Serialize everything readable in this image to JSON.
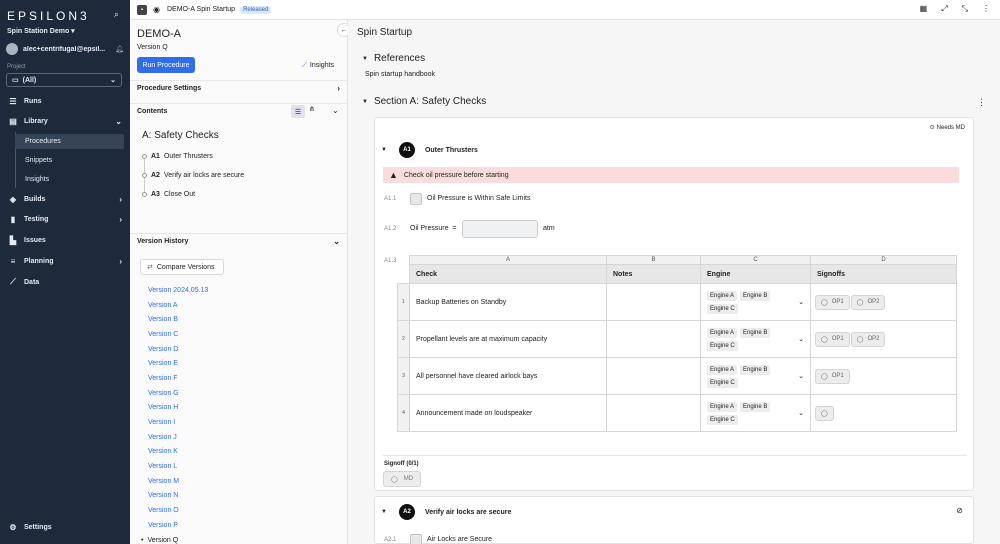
{
  "nav": {
    "logo": "EPSILON3",
    "station": "Spin Station Demo ▾",
    "user_email": "alec+centrifugal@epsil...",
    "project_label": "Project",
    "project_value": "(All)",
    "items": {
      "runs": "Runs",
      "library": "Library",
      "procedures": "Procedures",
      "snippets": "Snippets",
      "insights": "Insights",
      "builds": "Builds",
      "testing": "Testing",
      "issues": "Issues",
      "planning": "Planning",
      "data": "Data",
      "settings": "Settings"
    }
  },
  "topbar": {
    "title": "DEMO-A Spin Startup",
    "badge": "Released"
  },
  "sidepanel": {
    "proc_id": "DEMO-A",
    "version": "Version Q",
    "run_button": "Run Procedure",
    "insights": "Insights",
    "settings_header": "Procedure Settings",
    "contents_header": "Contents",
    "section": "A: Safety Checks",
    "outline": [
      {
        "num": "A1",
        "label": "Outer Thrusters"
      },
      {
        "num": "A2",
        "label": "Verify air locks are secure"
      },
      {
        "num": "A3",
        "label": "Close Out"
      }
    ],
    "history_header": "Version History",
    "compare_button": "Compare Versions",
    "versions": [
      "Version 2024.05.13",
      "Version A",
      "Version B",
      "Version C",
      "Version D",
      "Version E",
      "Version F",
      "Version G",
      "Version H",
      "Version I",
      "Version J",
      "Version K",
      "Version L",
      "Version M",
      "Version N",
      "Version O",
      "Version P",
      "Version Q"
    ]
  },
  "main": {
    "title": "Spin Startup",
    "references_header": "References",
    "references_item": "Spin startup handbook",
    "section_header": "Section A: Safety Checks",
    "step1": {
      "num": "A1",
      "title": "Outer Thrusters",
      "needs": "Needs MD",
      "warning": "Check oil pressure before starting",
      "sub1_num": "A1.1",
      "sub1_label": "Oil Pressure is Within Safe Limits",
      "sub2_num": "A1.2",
      "sub2_label": "Oil Pressure",
      "sub2_eq": "=",
      "sub2_unit": "atm",
      "sub3_num": "A1.3",
      "table": {
        "col_letters": [
          "A",
          "B",
          "C",
          "D"
        ],
        "headers": [
          "Check",
          "Notes",
          "Engine",
          "Signoffs"
        ],
        "rows": [
          {
            "n": "1",
            "check": "Backup Batteries on Standby",
            "engines": [
              "Engine A",
              "Engine B",
              "Engine C"
            ],
            "signoffs": [
              "OP1",
              "OP2"
            ]
          },
          {
            "n": "2",
            "check": "Propellant levels are at maximum capacity",
            "engines": [
              "Engine A",
              "Engine B",
              "Engine C"
            ],
            "signoffs": [
              "OP1",
              "OP2"
            ]
          },
          {
            "n": "3",
            "check": "All personnel have cleared airlock bays",
            "engines": [
              "Engine A",
              "Engine B",
              "Engine C"
            ],
            "signoffs": [
              "OP1"
            ]
          },
          {
            "n": "4",
            "check": "Announcement made on loudspeaker",
            "engines": [
              "Engine A",
              "Engine B",
              "Engine C"
            ],
            "signoffs": [
              ""
            ]
          }
        ]
      },
      "signoff_label": "Signoff (0/1)",
      "signoff_btn": "MD"
    },
    "step2": {
      "num": "A2",
      "title": "Verify air locks are secure",
      "sub1_num": "A2.1",
      "sub1_label": "Air Locks are Secure"
    }
  }
}
